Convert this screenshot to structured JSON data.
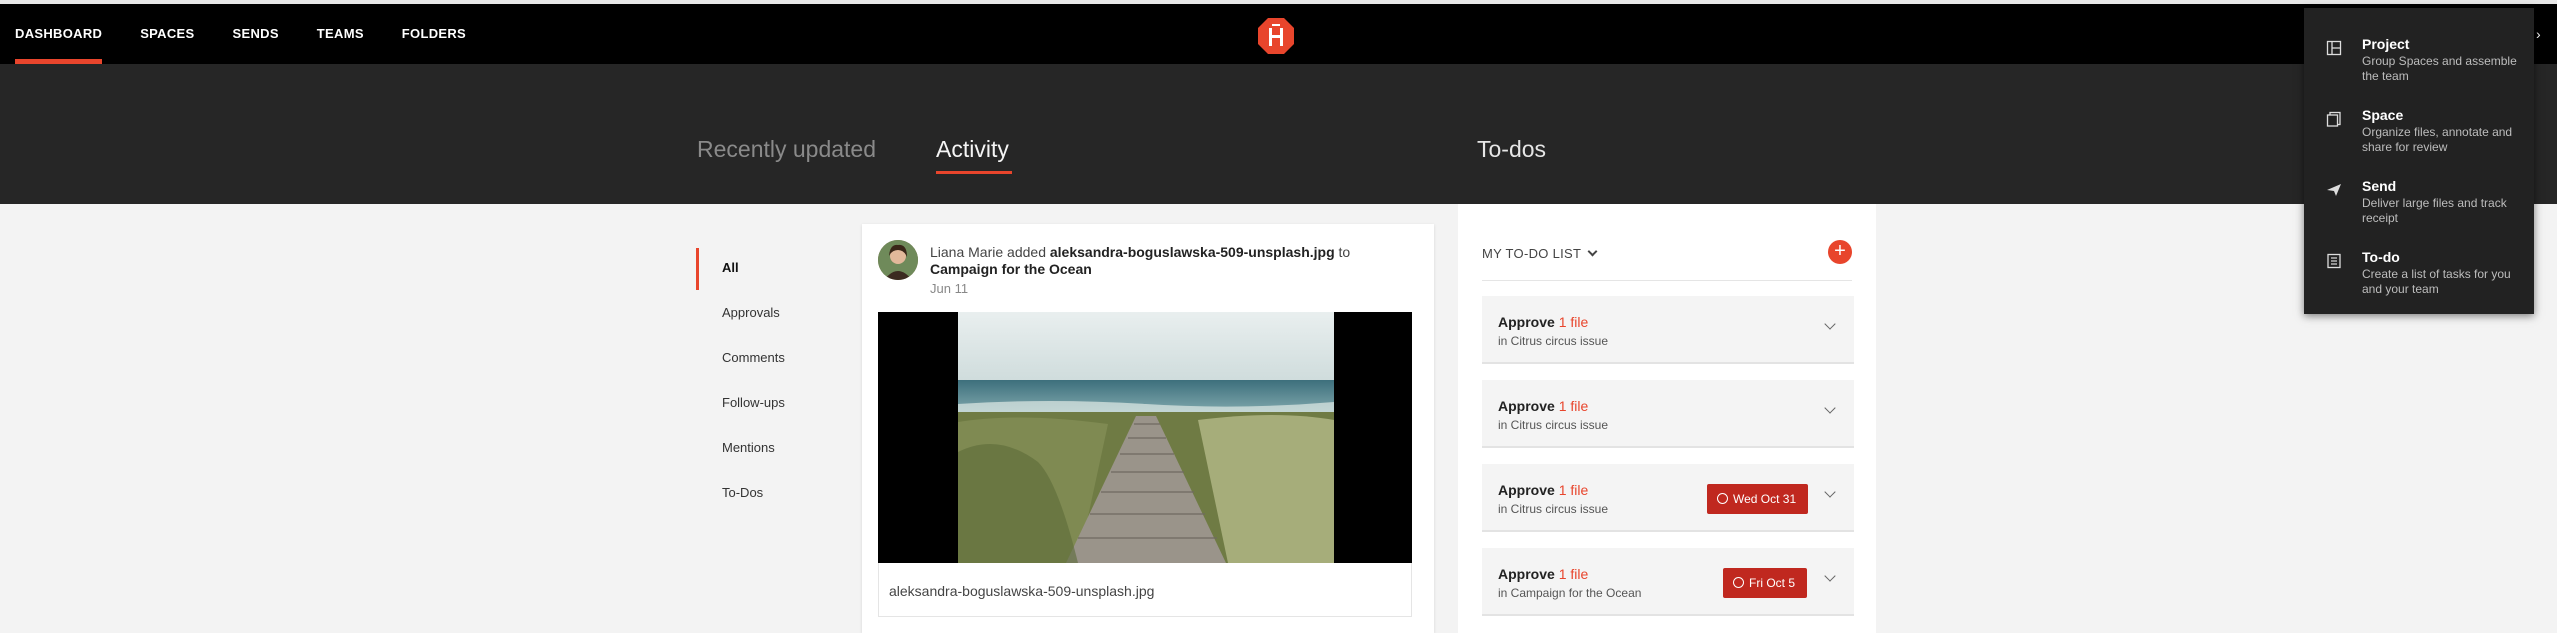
{
  "nav": {
    "items": [
      {
        "label": "DASHBOARD",
        "active": true
      },
      {
        "label": "SPACES"
      },
      {
        "label": "SENDS"
      },
      {
        "label": "TEAMS"
      },
      {
        "label": "FOLDERS"
      }
    ],
    "logo": "hightail-logo-icon",
    "accent_color": "#e8452c"
  },
  "tabs": [
    {
      "label": "Recently updated"
    },
    {
      "label": "Activity",
      "active": true
    },
    {
      "label": "To-dos"
    }
  ],
  "filters": [
    "All",
    "Approvals",
    "Comments",
    "Follow-ups",
    "Mentions",
    "To-Dos"
  ],
  "activity": {
    "user": "Liana Marie",
    "verb": "added",
    "file": "aleksandra-boguslawska-509-unsplash.jpg",
    "preposition": "to",
    "space": "Campaign for the Ocean",
    "date": "Jun 11",
    "filename": "aleksandra-boguslawska-509-unsplash.jpg"
  },
  "todo": {
    "header": "MY TO-DO LIST",
    "add_label": "+",
    "items": [
      {
        "action": "Approve",
        "count": "1 file",
        "location": "in Citrus circus issue"
      },
      {
        "action": "Approve",
        "count": "1 file",
        "location": "in Citrus circus issue"
      },
      {
        "action": "Approve",
        "count": "1 file",
        "location": "in Citrus circus issue",
        "due": "Wed Oct 31"
      },
      {
        "action": "Approve",
        "count": "1 file",
        "location": "in Campaign for the Ocean",
        "due": "Fri Oct 5"
      }
    ],
    "due_color": "#c0281f"
  },
  "create_menu": [
    {
      "title": "Project",
      "desc": "Group Spaces and assemble the team",
      "icon": "project-icon"
    },
    {
      "title": "Space",
      "desc": "Organize files, annotate and share for review",
      "icon": "space-icon"
    },
    {
      "title": "Send",
      "desc": "Deliver large files and track receipt",
      "icon": "send-icon"
    },
    {
      "title": "To-do",
      "desc": "Create a list of tasks for you and your team",
      "icon": "todo-icon"
    }
  ]
}
